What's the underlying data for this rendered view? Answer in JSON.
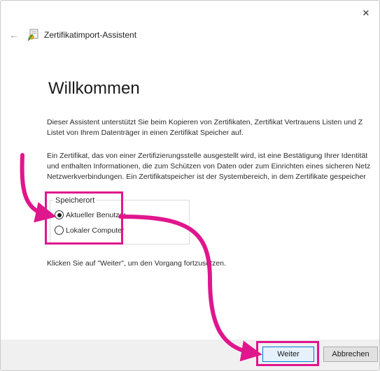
{
  "window": {
    "title": "Zertifikatimport-Assistent",
    "close_glyph": "✕",
    "back_glyph": "←"
  },
  "page": {
    "heading": "Willkommen",
    "intro_line1": "Dieser Assistent unterstützt Sie beim Kopieren von Zertifikaten, Zertifikat Vertrauens Listen und Z",
    "intro_line2": "Listet von Ihrem Datenträger in einen Zertifikat Speicher auf.",
    "info_line1": "Ein Zertifikat, das von einer Zertifizierungsstelle ausgestellt wird, ist eine Bestätigung Ihrer Identität",
    "info_line2": "und enthalten Informationen, die zum Schützen von Daten oder zum Einrichten eines sicheren Netz",
    "info_line3": "Netzwerkverbindungen. Ein Zertifikatspeicher ist der Systembereich, in dem Zertifikate gespeicher",
    "continue_text": "Klicken Sie auf \"Weiter\", um den Vorgang fortzusetzen."
  },
  "store_location": {
    "legend": "Speicherort",
    "options": [
      {
        "label": "Aktueller Benutzer",
        "selected": true
      },
      {
        "label": "Lokaler Computer",
        "selected": false
      }
    ]
  },
  "buttons": {
    "next": "Weiter",
    "cancel": "Abbrechen"
  },
  "icons": {
    "close": "close-icon",
    "back": "back-arrow-icon",
    "wizard": "certificate-wizard-icon"
  },
  "colors": {
    "annotation": "#e0168d",
    "default_button_border": "#0078d7",
    "footer": "#f0f0f0"
  }
}
